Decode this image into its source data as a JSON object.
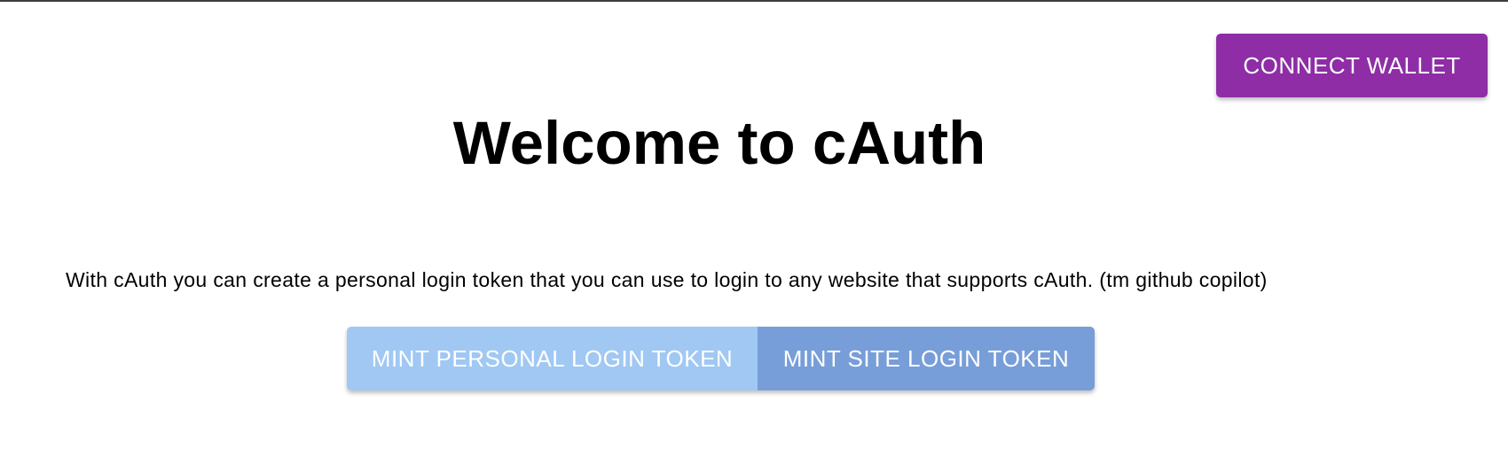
{
  "header": {
    "connect_wallet_label": "CONNECT WALLET"
  },
  "main": {
    "title": "Welcome to cAuth",
    "description": "With cAuth you can create a personal login token that you can use to login to any website that supports cAuth. (tm github copilot)",
    "actions": {
      "mint_personal_label": "MINT PERSONAL LOGIN TOKEN",
      "mint_site_label": "MINT SITE LOGIN TOKEN"
    }
  },
  "colors": {
    "connect_wallet_bg": "#8e2da6",
    "mint_personal_bg": "#a0c8f3",
    "mint_site_bg": "#779ed9",
    "text": "#000000"
  }
}
